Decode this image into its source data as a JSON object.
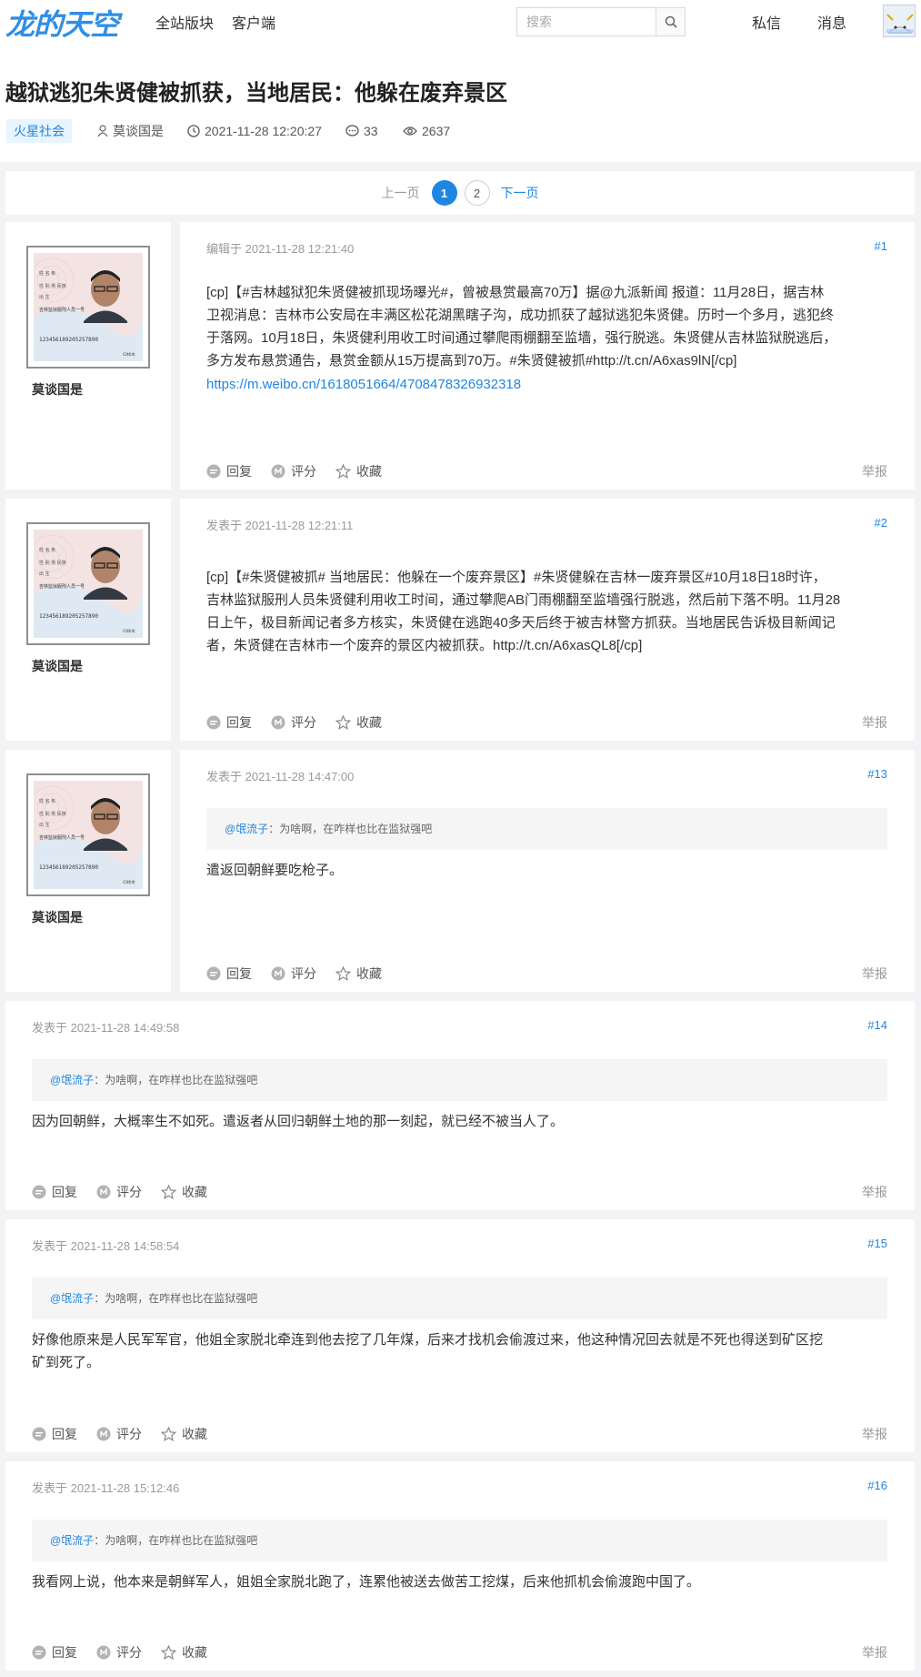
{
  "header": {
    "logo_text": "龙的天空",
    "nav": [
      "全站版块",
      "客户端"
    ],
    "search_placeholder": "搜索",
    "right_links": [
      "私信",
      "消息"
    ]
  },
  "thread": {
    "title": "越狱逃犯朱贤健被抓获，当地居民：他躲在废弃景区",
    "tag": "火星社会",
    "author": "莫谈国是",
    "datetime": "2021-11-28 12:20:27",
    "replies": "33",
    "views": "2637"
  },
  "pagination": {
    "prev": "上一页",
    "pages": [
      "1",
      "2"
    ],
    "current": "1",
    "next": "下一页"
  },
  "labels": {
    "reply": "回复",
    "rate": "评分",
    "fav": "收藏",
    "report": "举报"
  },
  "posts": [
    {
      "author": "莫谈国是",
      "time": "编辑于 2021-11-28 12:21:40",
      "num": "#1",
      "lines": [
        "[cp]【#吉林越狱犯朱贤健被抓现场曝光#，曾被悬赏最高70万】据@九派新闻 报道：11月28日，据吉林",
        "卫视消息：吉林市公安局在丰满区松花湖黑瞎子沟，成功抓获了越狱逃犯朱贤健。历时一个多月，逃犯终",
        "于落网。10月18日，朱贤健利用收工时间通过攀爬雨棚翻至监墙，强行脱逃。朱贤健从吉林监狱脱逃后，",
        "多方发布悬赏通告，悬赏金额从15万提高到70万。#朱贤健被抓#http://t.cn/A6xas9lN[/cp]"
      ],
      "link": "https://m.weibo.cn/1618051664/4708478326932318"
    },
    {
      "author": "莫谈国是",
      "time": "发表于 2021-11-28 12:21:11",
      "num": "#2",
      "lines": [
        "[cp]【#朱贤健被抓# 当地居民：他躲在一个废弃景区】#朱贤健躲在吉林一废弃景区#10月18日18时许，",
        "吉林监狱服刑人员朱贤健利用收工时间，通过攀爬AB门雨棚翻至监墙强行脱逃，然后前下落不明。11月28",
        "日上午，极目新闻记者多方核实，朱贤健在逃跑40多天后终于被吉林警方抓获。当地居民告诉极目新闻记",
        "者，朱贤健在吉林市一个废弃的景区内被抓获。http://t.cn/A6xasQL8[/cp]"
      ]
    },
    {
      "author": "莫谈国是",
      "time": "发表于 2021-11-28 14:47:00",
      "num": "#13",
      "quote_user": "@氓流子",
      "quote_text": "：为啥啊，在咋样也比在监狱强吧",
      "lines": [
        "遣返回朝鲜要吃枪子。"
      ]
    },
    {
      "time": "发表于 2021-11-28 14:49:58",
      "num": "#14",
      "quote_user": "@氓流子",
      "quote_text": "：为啥啊，在咋样也比在监狱强吧",
      "lines": [
        "因为回朝鲜，大概率生不如死。遣返者从回归朝鲜土地的那一刻起，就已经不被当人了。"
      ]
    },
    {
      "time": "发表于 2021-11-28 14:58:54",
      "num": "#15",
      "quote_user": "@氓流子",
      "quote_text": "：为啥啊，在咋样也比在监狱强吧",
      "lines": [
        "好像他原来是人民军军官，他姐全家脱北牵连到他去挖了几年煤，后来才找机会偷渡过来，他这种情况回去就是不死也得送到矿区挖",
        "矿到死了。"
      ]
    },
    {
      "time": "发表于 2021-11-28 15:12:46",
      "num": "#16",
      "quote_user": "@氓流子",
      "quote_text": "：为啥啊，在咋样也比在监狱强吧",
      "lines": [
        "我看网上说，他本来是朝鲜军人，姐姐全家脱北跑了，连累他被送去做苦工挖煤，后来他抓机会偷渡跑中国了。"
      ]
    }
  ],
  "avatar_card": {
    "line1": "姓  名  朱",
    "line2": "性  别  男  民族",
    "line3": "出  生",
    "line4": "吉林监狱服刑人员一号",
    "id_no": "123456189205257890",
    "stamp": "ID样本"
  }
}
